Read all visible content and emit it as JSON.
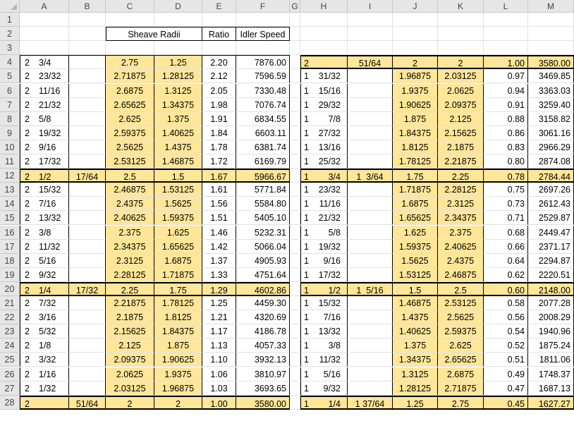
{
  "columns": [
    "A",
    "B",
    "C",
    "D",
    "E",
    "F",
    "G",
    "H",
    "I",
    "J",
    "K",
    "L",
    "M"
  ],
  "rows": [
    "1",
    "2",
    "3",
    "4",
    "5",
    "6",
    "7",
    "8",
    "9",
    "10",
    "11",
    "12",
    "13",
    "14",
    "15",
    "16",
    "17",
    "18",
    "19",
    "20",
    "21",
    "22",
    "23",
    "24",
    "25",
    "26",
    "27",
    "28"
  ],
  "headers": {
    "sheave_radii": "Sheave Radii",
    "ratio": "Ratio",
    "idler_speed": "Idler Speed"
  },
  "left_table": [
    {
      "a_int": "2",
      "a_frac": "3/4",
      "b": "",
      "c": "2.75",
      "d": "1.25",
      "e": "2.20",
      "f": "7876.00"
    },
    {
      "a_int": "2",
      "a_frac": "23/32",
      "b": "",
      "c": "2.71875",
      "d": "1.28125",
      "e": "2.12",
      "f": "7596.59"
    },
    {
      "a_int": "2",
      "a_frac": "11/16",
      "b": "",
      "c": "2.6875",
      "d": "1.3125",
      "e": "2.05",
      "f": "7330.48"
    },
    {
      "a_int": "2",
      "a_frac": "21/32",
      "b": "",
      "c": "2.65625",
      "d": "1.34375",
      "e": "1.98",
      "f": "7076.74"
    },
    {
      "a_int": "2",
      "a_frac": "5/8",
      "b": "",
      "c": "2.625",
      "d": "1.375",
      "e": "1.91",
      "f": "6834.55"
    },
    {
      "a_int": "2",
      "a_frac": "19/32",
      "b": "",
      "c": "2.59375",
      "d": "1.40625",
      "e": "1.84",
      "f": "6603.11"
    },
    {
      "a_int": "2",
      "a_frac": "9/16",
      "b": "",
      "c": "2.5625",
      "d": "1.4375",
      "e": "1.78",
      "f": "6381.74"
    },
    {
      "a_int": "2",
      "a_frac": "17/32",
      "b": "",
      "c": "2.53125",
      "d": "1.46875",
      "e": "1.72",
      "f": "6169.79"
    },
    {
      "a_int": "2",
      "a_frac": "1/2",
      "b": "17/64",
      "c": "2.5",
      "d": "1.5",
      "e": "1.67",
      "f": "5966.67"
    },
    {
      "a_int": "2",
      "a_frac": "15/32",
      "b": "",
      "c": "2.46875",
      "d": "1.53125",
      "e": "1.61",
      "f": "5771.84"
    },
    {
      "a_int": "2",
      "a_frac": "7/16",
      "b": "",
      "c": "2.4375",
      "d": "1.5625",
      "e": "1.56",
      "f": "5584.80"
    },
    {
      "a_int": "2",
      "a_frac": "13/32",
      "b": "",
      "c": "2.40625",
      "d": "1.59375",
      "e": "1.51",
      "f": "5405.10"
    },
    {
      "a_int": "2",
      "a_frac": "3/8",
      "b": "",
      "c": "2.375",
      "d": "1.625",
      "e": "1.46",
      "f": "5232.31"
    },
    {
      "a_int": "2",
      "a_frac": "11/32",
      "b": "",
      "c": "2.34375",
      "d": "1.65625",
      "e": "1.42",
      "f": "5066.04"
    },
    {
      "a_int": "2",
      "a_frac": "5/16",
      "b": "",
      "c": "2.3125",
      "d": "1.6875",
      "e": "1.37",
      "f": "4905.93"
    },
    {
      "a_int": "2",
      "a_frac": "9/32",
      "b": "",
      "c": "2.28125",
      "d": "1.71875",
      "e": "1.33",
      "f": "4751.64"
    },
    {
      "a_int": "2",
      "a_frac": "1/4",
      "b": "17/32",
      "c": "2.25",
      "d": "1.75",
      "e": "1.29",
      "f": "4602.86"
    },
    {
      "a_int": "2",
      "a_frac": "7/32",
      "b": "",
      "c": "2.21875",
      "d": "1.78125",
      "e": "1.25",
      "f": "4459.30"
    },
    {
      "a_int": "2",
      "a_frac": "3/16",
      "b": "",
      "c": "2.1875",
      "d": "1.8125",
      "e": "1.21",
      "f": "4320.69"
    },
    {
      "a_int": "2",
      "a_frac": "5/32",
      "b": "",
      "c": "2.15625",
      "d": "1.84375",
      "e": "1.17",
      "f": "4186.78"
    },
    {
      "a_int": "2",
      "a_frac": "1/8",
      "b": "",
      "c": "2.125",
      "d": "1.875",
      "e": "1.13",
      "f": "4057.33"
    },
    {
      "a_int": "2",
      "a_frac": "3/32",
      "b": "",
      "c": "2.09375",
      "d": "1.90625",
      "e": "1.10",
      "f": "3932.13"
    },
    {
      "a_int": "2",
      "a_frac": "1/16",
      "b": "",
      "c": "2.0625",
      "d": "1.9375",
      "e": "1.06",
      "f": "3810.97"
    },
    {
      "a_int": "2",
      "a_frac": "1/32",
      "b": "",
      "c": "2.03125",
      "d": "1.96875",
      "e": "1.03",
      "f": "3693.65"
    },
    {
      "a_int": "2",
      "a_frac": "",
      "b": "51/64",
      "c": "2",
      "d": "2",
      "e": "1.00",
      "f": "3580.00"
    }
  ],
  "right_table": [
    {
      "h_int": "2",
      "h_frac": "",
      "i": "51/64",
      "j": "2",
      "k": "2",
      "l": "1.00",
      "m": "3580.00"
    },
    {
      "h_int": "1",
      "h_frac": "31/32",
      "i": "",
      "j": "1.96875",
      "k": "2.03125",
      "l": "0.97",
      "m": "3469.85"
    },
    {
      "h_int": "1",
      "h_frac": "15/16",
      "i": "",
      "j": "1.9375",
      "k": "2.0625",
      "l": "0.94",
      "m": "3363.03"
    },
    {
      "h_int": "1",
      "h_frac": "29/32",
      "i": "",
      "j": "1.90625",
      "k": "2.09375",
      "l": "0.91",
      "m": "3259.40"
    },
    {
      "h_int": "1",
      "h_frac": "7/8",
      "i": "",
      "j": "1.875",
      "k": "2.125",
      "l": "0.88",
      "m": "3158.82"
    },
    {
      "h_int": "1",
      "h_frac": "27/32",
      "i": "",
      "j": "1.84375",
      "k": "2.15625",
      "l": "0.86",
      "m": "3061.16"
    },
    {
      "h_int": "1",
      "h_frac": "13/16",
      "i": "",
      "j": "1.8125",
      "k": "2.1875",
      "l": "0.83",
      "m": "2966.29"
    },
    {
      "h_int": "1",
      "h_frac": "25/32",
      "i": "",
      "j": "1.78125",
      "k": "2.21875",
      "l": "0.80",
      "m": "2874.08"
    },
    {
      "h_int": "1",
      "h_frac": "3/4",
      "i": "1  3/64",
      "j": "1.75",
      "k": "2.25",
      "l": "0.78",
      "m": "2784.44"
    },
    {
      "h_int": "1",
      "h_frac": "23/32",
      "i": "",
      "j": "1.71875",
      "k": "2.28125",
      "l": "0.75",
      "m": "2697.26"
    },
    {
      "h_int": "1",
      "h_frac": "11/16",
      "i": "",
      "j": "1.6875",
      "k": "2.3125",
      "l": "0.73",
      "m": "2612.43"
    },
    {
      "h_int": "1",
      "h_frac": "21/32",
      "i": "",
      "j": "1.65625",
      "k": "2.34375",
      "l": "0.71",
      "m": "2529.87"
    },
    {
      "h_int": "1",
      "h_frac": "5/8",
      "i": "",
      "j": "1.625",
      "k": "2.375",
      "l": "0.68",
      "m": "2449.47"
    },
    {
      "h_int": "1",
      "h_frac": "19/32",
      "i": "",
      "j": "1.59375",
      "k": "2.40625",
      "l": "0.66",
      "m": "2371.17"
    },
    {
      "h_int": "1",
      "h_frac": "9/16",
      "i": "",
      "j": "1.5625",
      "k": "2.4375",
      "l": "0.64",
      "m": "2294.87"
    },
    {
      "h_int": "1",
      "h_frac": "17/32",
      "i": "",
      "j": "1.53125",
      "k": "2.46875",
      "l": "0.62",
      "m": "2220.51"
    },
    {
      "h_int": "1",
      "h_frac": "1/2",
      "i": "1  5/16",
      "j": "1.5",
      "k": "2.5",
      "l": "0.60",
      "m": "2148.00"
    },
    {
      "h_int": "1",
      "h_frac": "15/32",
      "i": "",
      "j": "1.46875",
      "k": "2.53125",
      "l": "0.58",
      "m": "2077.28"
    },
    {
      "h_int": "1",
      "h_frac": "7/16",
      "i": "",
      "j": "1.4375",
      "k": "2.5625",
      "l": "0.56",
      "m": "2008.29"
    },
    {
      "h_int": "1",
      "h_frac": "13/32",
      "i": "",
      "j": "1.40625",
      "k": "2.59375",
      "l": "0.54",
      "m": "1940.96"
    },
    {
      "h_int": "1",
      "h_frac": "3/8",
      "i": "",
      "j": "1.375",
      "k": "2.625",
      "l": "0.52",
      "m": "1875.24"
    },
    {
      "h_int": "1",
      "h_frac": "11/32",
      "i": "",
      "j": "1.34375",
      "k": "2.65625",
      "l": "0.51",
      "m": "1811.06"
    },
    {
      "h_int": "1",
      "h_frac": "5/16",
      "i": "",
      "j": "1.3125",
      "k": "2.6875",
      "l": "0.49",
      "m": "1748.37"
    },
    {
      "h_int": "1",
      "h_frac": "9/32",
      "i": "",
      "j": "1.28125",
      "k": "2.71875",
      "l": "0.47",
      "m": "1687.13"
    },
    {
      "h_int": "1",
      "h_frac": "1/4",
      "i": "1 37/64",
      "j": "1.25",
      "k": "2.75",
      "l": "0.45",
      "m": "1627.27"
    }
  ],
  "colors": {
    "header_bg": "#e6e6e6",
    "highlight": "#ffe699",
    "gridline": "#e1e1e1",
    "border": "#000000"
  }
}
